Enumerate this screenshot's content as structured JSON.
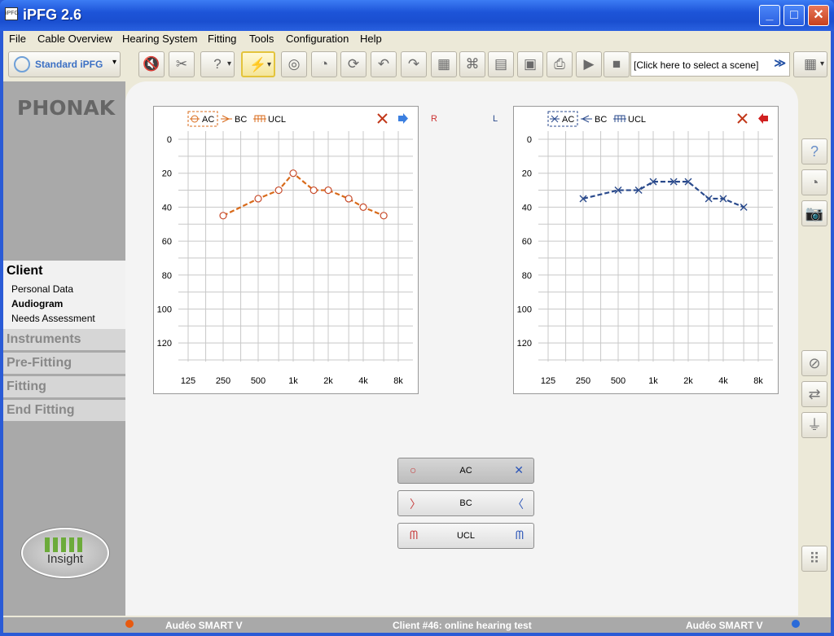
{
  "window": {
    "title": "iPFG 2.6",
    "icon_text": "iPFG"
  },
  "menu": [
    "File",
    "Cable Overview",
    "Hearing System",
    "Fitting",
    "Tools",
    "Configuration",
    "Help"
  ],
  "toolbar": {
    "profile_label": "Standard iPFG",
    "scene_placeholder": "[Click here to select a scene]",
    "buttons": [
      {
        "name": "mute-left-icon",
        "glyph": "🔇"
      },
      {
        "name": "mute-right-icon",
        "glyph": "✂"
      },
      {
        "name": "hearing-aid-question-icon",
        "glyph": "?"
      },
      {
        "name": "hearing-aid-flash-icon",
        "glyph": "⚡"
      },
      {
        "name": "target-icon",
        "glyph": "◎"
      },
      {
        "name": "ear-hook-icon",
        "glyph": "◔"
      },
      {
        "name": "refresh-icon",
        "glyph": "⟳"
      },
      {
        "name": "undo-icon",
        "glyph": "↶"
      },
      {
        "name": "redo-icon",
        "glyph": "↷"
      },
      {
        "name": "hearing-aid-grid-icon",
        "glyph": "▦"
      },
      {
        "name": "tree-icon",
        "glyph": "⌘"
      },
      {
        "name": "chart-icon",
        "glyph": "▤"
      },
      {
        "name": "save-icon",
        "glyph": "▣"
      },
      {
        "name": "print-icon",
        "glyph": "⎙"
      },
      {
        "name": "play-icon",
        "glyph": "▶"
      },
      {
        "name": "stop-icon",
        "glyph": "■"
      }
    ]
  },
  "sidebar": {
    "logo": "PHONAK",
    "sections": [
      "Client",
      "Instruments",
      "Pre-Fitting",
      "Fitting",
      "End Fitting"
    ],
    "client_items": [
      "Personal Data",
      "Audiogram",
      "Needs Assessment"
    ],
    "insight_label": "Insight"
  },
  "audiogram": {
    "side_right": "R",
    "side_left": "L",
    "legend": {
      "ac": "AC",
      "bc": "BC",
      "ucl": "UCL"
    },
    "y_ticks": [
      "0",
      "20",
      "40",
      "60",
      "80",
      "100",
      "120"
    ],
    "x_ticks": [
      "125",
      "250",
      "500",
      "1k",
      "2k",
      "4k",
      "8k"
    ]
  },
  "chart_data": [
    {
      "type": "line",
      "side": "right",
      "color": "#d86a1a",
      "series": [
        {
          "name": "AC",
          "marker": "circle",
          "x": [
            250,
            500,
            750,
            1000,
            1500,
            2000,
            3000,
            4000,
            6000
          ],
          "values": [
            45,
            35,
            30,
            20,
            30,
            30,
            35,
            40,
            45
          ]
        }
      ],
      "ylim": [
        0,
        130
      ],
      "xlim": [
        125,
        8000
      ],
      "x_scale": "log",
      "y_inverted": true,
      "grid": true
    },
    {
      "type": "line",
      "side": "left",
      "color": "#2a4a8c",
      "series": [
        {
          "name": "AC",
          "marker": "x",
          "x": [
            250,
            500,
            750,
            1000,
            1500,
            2000,
            3000,
            4000,
            6000
          ],
          "values": [
            35,
            30,
            30,
            25,
            25,
            25,
            35,
            35,
            40
          ]
        }
      ],
      "ylim": [
        0,
        130
      ],
      "xlim": [
        125,
        8000
      ],
      "x_scale": "log",
      "y_inverted": true,
      "grid": true
    }
  ],
  "buttons": {
    "ac": "AC",
    "bc": "BC",
    "ucl": "UCL"
  },
  "status": {
    "left_device": "Audéo SMART V",
    "client": "Client #46: online hearing test",
    "right_device": "Audéo SMART V",
    "left_color": "#e85a10",
    "right_color": "#2a6ad8"
  }
}
